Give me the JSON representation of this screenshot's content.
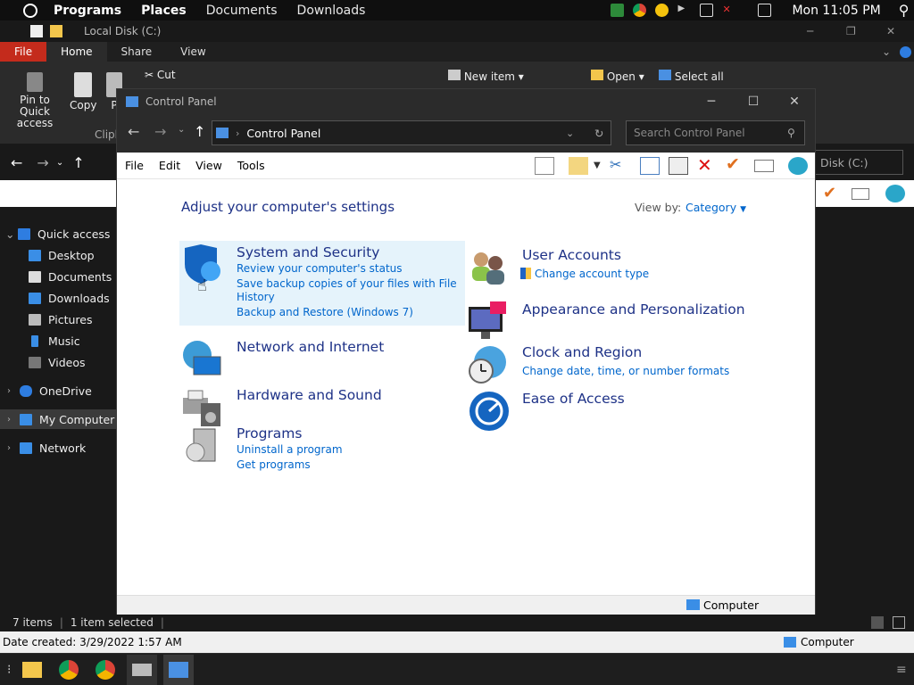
{
  "topbar": {
    "menus": [
      "Programs",
      "Places",
      "Documents",
      "Downloads"
    ],
    "clock": "Mon 11:05 PM"
  },
  "explorer": {
    "title": "Local Disk (C:)",
    "tabs": [
      "File",
      "Home",
      "Share",
      "View"
    ],
    "ribbon": {
      "pin": "Pin to Quick access",
      "copy": "Copy",
      "paste_partial": "P",
      "cut": "Cut",
      "clipboard_partial": "Clipb",
      "new_item": "New item",
      "open": "Open",
      "select_all": "Select all"
    },
    "address_partial": "Disk (C:)",
    "sidebar": [
      "Quick access",
      "Desktop",
      "Documents",
      "Downloads",
      "Pictures",
      "Music",
      "Videos",
      "OneDrive",
      "My Computer",
      "Network"
    ],
    "status": {
      "items": "7 items",
      "selected": "1 item selected",
      "date_created": "Date created: 3/29/2022 1:57 AM",
      "computer": "Computer"
    }
  },
  "cp": {
    "title": "Control Panel",
    "address": "Control Panel",
    "search_placeholder": "Search Control Panel",
    "menus": [
      "File",
      "Edit",
      "View",
      "Tools"
    ],
    "heading": "Adjust your computer's settings",
    "view_by_label": "View by:",
    "view_by_value": "Category",
    "categories": [
      {
        "title": "System and Security",
        "links": [
          "Review your computer's status",
          "Save backup copies of your files with File",
          "History",
          "Backup and Restore (Windows 7)"
        ]
      },
      {
        "title": "Network and Internet",
        "links": []
      },
      {
        "title": "Hardware and Sound",
        "links": []
      },
      {
        "title": "Programs",
        "links": [
          "Uninstall a program",
          "Get programs"
        ]
      },
      {
        "title": "User Accounts",
        "links": [
          "Change account type"
        ]
      },
      {
        "title": "Appearance and Personalization",
        "links": []
      },
      {
        "title": "Clock and Region",
        "links": [
          "Change date, time, or number formats"
        ]
      },
      {
        "title": "Ease of Access",
        "links": []
      }
    ],
    "status_computer": "Computer"
  },
  "colors": {
    "link": "#0066cc",
    "heading": "#1e3287",
    "file_tab": "#c42b1c",
    "hover": "#e5f3fb"
  }
}
